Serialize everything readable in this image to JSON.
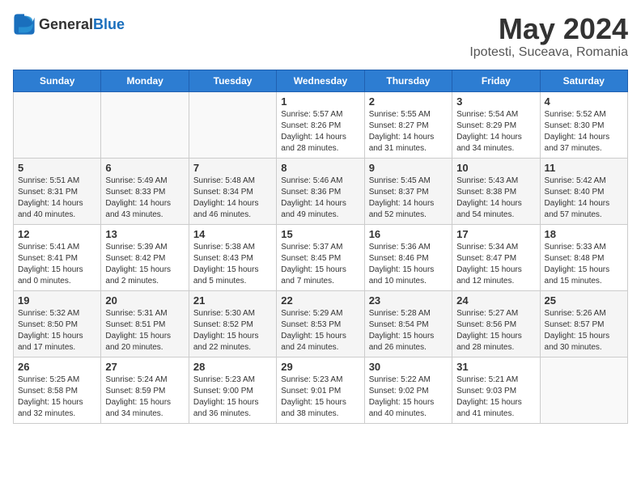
{
  "logo": {
    "general": "General",
    "blue": "Blue"
  },
  "title": "May 2024",
  "location": "Ipotesti, Suceava, Romania",
  "days_of_week": [
    "Sunday",
    "Monday",
    "Tuesday",
    "Wednesday",
    "Thursday",
    "Friday",
    "Saturday"
  ],
  "weeks": [
    [
      {
        "day": "",
        "info": ""
      },
      {
        "day": "",
        "info": ""
      },
      {
        "day": "",
        "info": ""
      },
      {
        "day": "1",
        "info": "Sunrise: 5:57 AM\nSunset: 8:26 PM\nDaylight: 14 hours\nand 28 minutes."
      },
      {
        "day": "2",
        "info": "Sunrise: 5:55 AM\nSunset: 8:27 PM\nDaylight: 14 hours\nand 31 minutes."
      },
      {
        "day": "3",
        "info": "Sunrise: 5:54 AM\nSunset: 8:29 PM\nDaylight: 14 hours\nand 34 minutes."
      },
      {
        "day": "4",
        "info": "Sunrise: 5:52 AM\nSunset: 8:30 PM\nDaylight: 14 hours\nand 37 minutes."
      }
    ],
    [
      {
        "day": "5",
        "info": "Sunrise: 5:51 AM\nSunset: 8:31 PM\nDaylight: 14 hours\nand 40 minutes."
      },
      {
        "day": "6",
        "info": "Sunrise: 5:49 AM\nSunset: 8:33 PM\nDaylight: 14 hours\nand 43 minutes."
      },
      {
        "day": "7",
        "info": "Sunrise: 5:48 AM\nSunset: 8:34 PM\nDaylight: 14 hours\nand 46 minutes."
      },
      {
        "day": "8",
        "info": "Sunrise: 5:46 AM\nSunset: 8:36 PM\nDaylight: 14 hours\nand 49 minutes."
      },
      {
        "day": "9",
        "info": "Sunrise: 5:45 AM\nSunset: 8:37 PM\nDaylight: 14 hours\nand 52 minutes."
      },
      {
        "day": "10",
        "info": "Sunrise: 5:43 AM\nSunset: 8:38 PM\nDaylight: 14 hours\nand 54 minutes."
      },
      {
        "day": "11",
        "info": "Sunrise: 5:42 AM\nSunset: 8:40 PM\nDaylight: 14 hours\nand 57 minutes."
      }
    ],
    [
      {
        "day": "12",
        "info": "Sunrise: 5:41 AM\nSunset: 8:41 PM\nDaylight: 15 hours\nand 0 minutes."
      },
      {
        "day": "13",
        "info": "Sunrise: 5:39 AM\nSunset: 8:42 PM\nDaylight: 15 hours\nand 2 minutes."
      },
      {
        "day": "14",
        "info": "Sunrise: 5:38 AM\nSunset: 8:43 PM\nDaylight: 15 hours\nand 5 minutes."
      },
      {
        "day": "15",
        "info": "Sunrise: 5:37 AM\nSunset: 8:45 PM\nDaylight: 15 hours\nand 7 minutes."
      },
      {
        "day": "16",
        "info": "Sunrise: 5:36 AM\nSunset: 8:46 PM\nDaylight: 15 hours\nand 10 minutes."
      },
      {
        "day": "17",
        "info": "Sunrise: 5:34 AM\nSunset: 8:47 PM\nDaylight: 15 hours\nand 12 minutes."
      },
      {
        "day": "18",
        "info": "Sunrise: 5:33 AM\nSunset: 8:48 PM\nDaylight: 15 hours\nand 15 minutes."
      }
    ],
    [
      {
        "day": "19",
        "info": "Sunrise: 5:32 AM\nSunset: 8:50 PM\nDaylight: 15 hours\nand 17 minutes."
      },
      {
        "day": "20",
        "info": "Sunrise: 5:31 AM\nSunset: 8:51 PM\nDaylight: 15 hours\nand 20 minutes."
      },
      {
        "day": "21",
        "info": "Sunrise: 5:30 AM\nSunset: 8:52 PM\nDaylight: 15 hours\nand 22 minutes."
      },
      {
        "day": "22",
        "info": "Sunrise: 5:29 AM\nSunset: 8:53 PM\nDaylight: 15 hours\nand 24 minutes."
      },
      {
        "day": "23",
        "info": "Sunrise: 5:28 AM\nSunset: 8:54 PM\nDaylight: 15 hours\nand 26 minutes."
      },
      {
        "day": "24",
        "info": "Sunrise: 5:27 AM\nSunset: 8:56 PM\nDaylight: 15 hours\nand 28 minutes."
      },
      {
        "day": "25",
        "info": "Sunrise: 5:26 AM\nSunset: 8:57 PM\nDaylight: 15 hours\nand 30 minutes."
      }
    ],
    [
      {
        "day": "26",
        "info": "Sunrise: 5:25 AM\nSunset: 8:58 PM\nDaylight: 15 hours\nand 32 minutes."
      },
      {
        "day": "27",
        "info": "Sunrise: 5:24 AM\nSunset: 8:59 PM\nDaylight: 15 hours\nand 34 minutes."
      },
      {
        "day": "28",
        "info": "Sunrise: 5:23 AM\nSunset: 9:00 PM\nDaylight: 15 hours\nand 36 minutes."
      },
      {
        "day": "29",
        "info": "Sunrise: 5:23 AM\nSunset: 9:01 PM\nDaylight: 15 hours\nand 38 minutes."
      },
      {
        "day": "30",
        "info": "Sunrise: 5:22 AM\nSunset: 9:02 PM\nDaylight: 15 hours\nand 40 minutes."
      },
      {
        "day": "31",
        "info": "Sunrise: 5:21 AM\nSunset: 9:03 PM\nDaylight: 15 hours\nand 41 minutes."
      },
      {
        "day": "",
        "info": ""
      }
    ]
  ]
}
